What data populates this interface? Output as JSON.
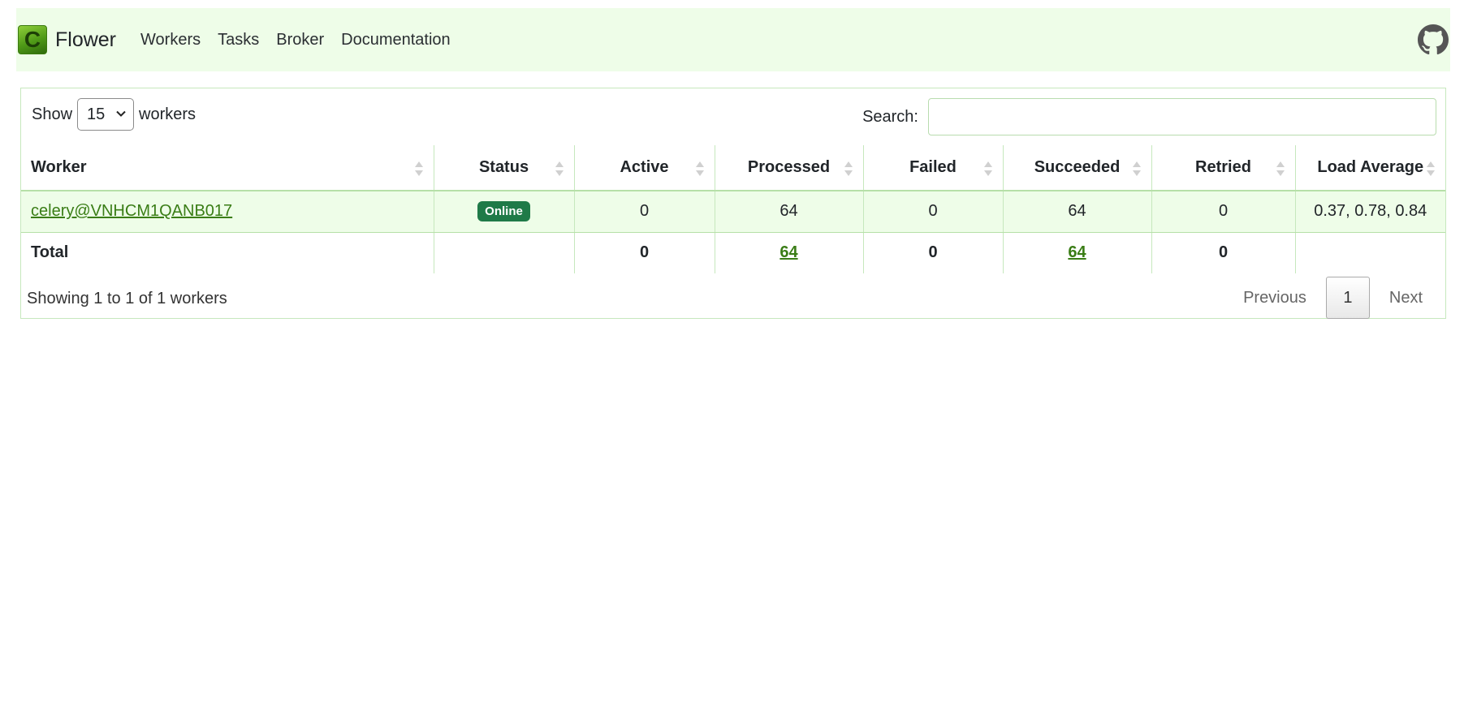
{
  "nav": {
    "brand": "Flower",
    "logo_letter": "C",
    "links": [
      "Workers",
      "Tasks",
      "Broker",
      "Documentation"
    ]
  },
  "controls": {
    "show_label": "Show",
    "page_size": "15",
    "entries_label": "workers",
    "search_label": "Search:",
    "search_value": ""
  },
  "table": {
    "columns": [
      "Worker",
      "Status",
      "Active",
      "Processed",
      "Failed",
      "Succeeded",
      "Retried",
      "Load Average"
    ],
    "rows": [
      {
        "worker": "celery@VNHCM1QANB017",
        "status": "Online",
        "active": "0",
        "processed": "64",
        "failed": "0",
        "succeeded": "64",
        "retried": "0",
        "load_average": "0.37, 0.78, 0.84"
      }
    ],
    "total": {
      "label": "Total",
      "active": "0",
      "processed": "64",
      "failed": "0",
      "succeeded": "64",
      "retried": "0"
    }
  },
  "footer": {
    "info": "Showing 1 to 1 of 1 workers",
    "previous": "Previous",
    "current_page": "1",
    "next": "Next"
  },
  "colors": {
    "navbar_bg": "#eefde8",
    "row_bg": "#eefde8",
    "link": "#3a7d16",
    "badge_online": "#1f7a48"
  },
  "icons": {
    "github": "github-icon",
    "sort": "sort-icon",
    "select": "chevron-down-icon"
  }
}
